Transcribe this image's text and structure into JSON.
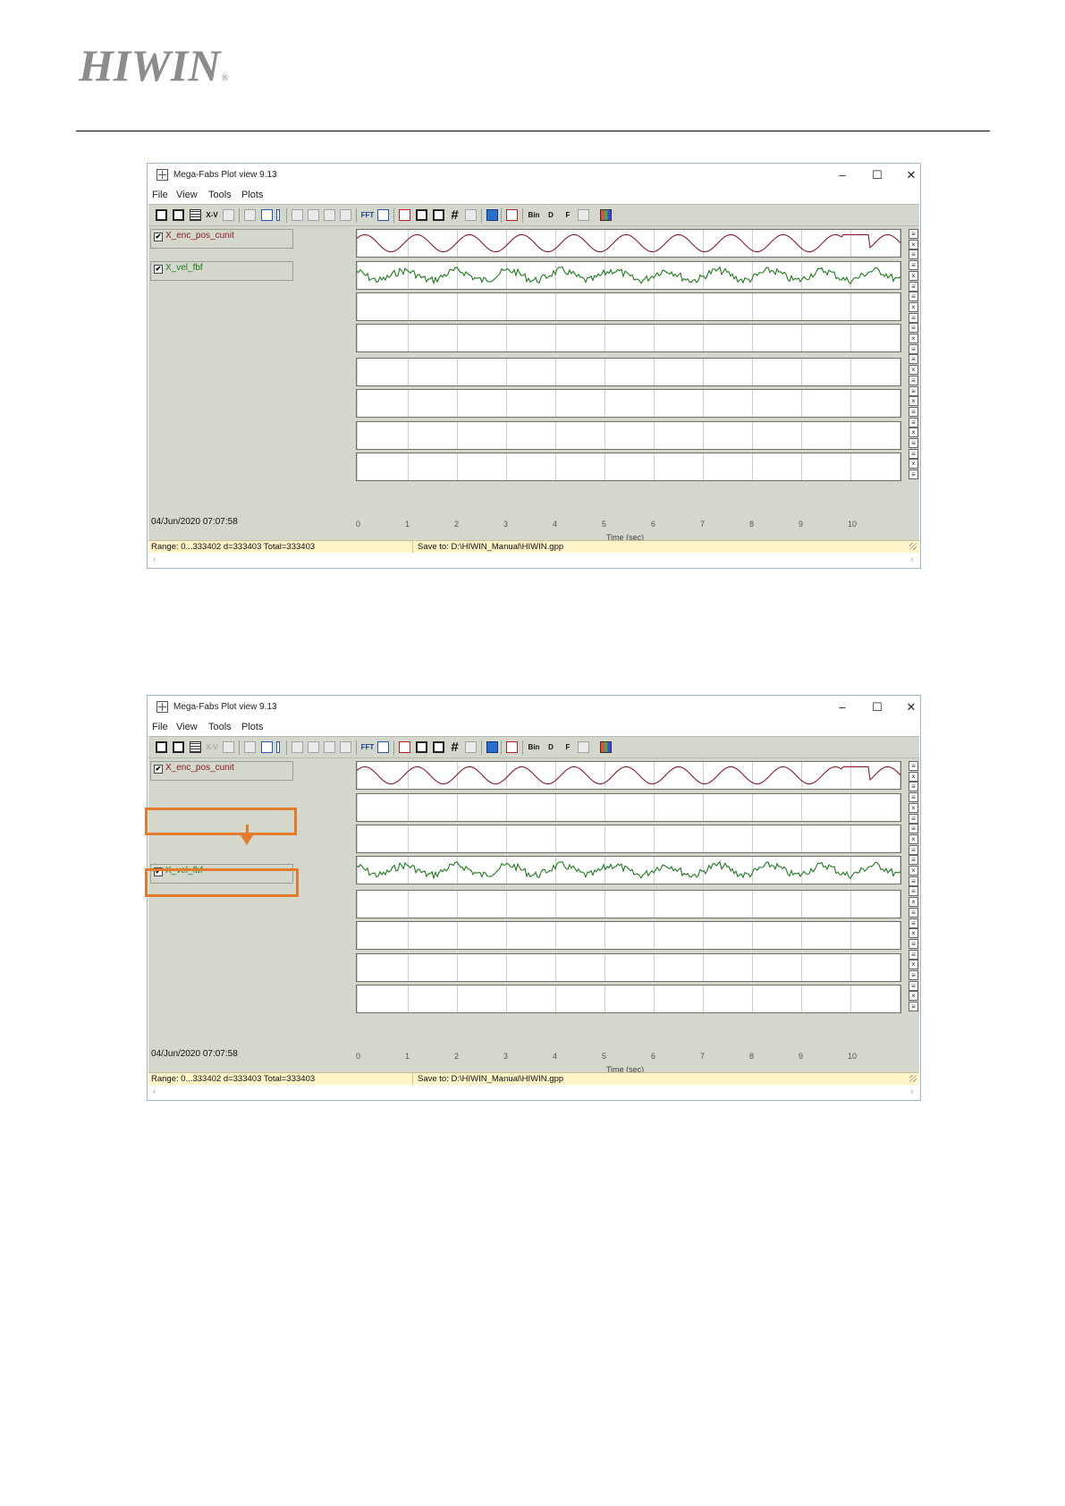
{
  "logo": {
    "text": "HIWIN",
    "mark": "®"
  },
  "windows": [
    {
      "title": "Mega-Fabs Plot view 9.13",
      "minimize": "–",
      "maximize": "☐",
      "close": "✕",
      "menu": [
        "File",
        "View",
        "Tools",
        "Plots"
      ],
      "toolbar_text": {
        "xv": "X-V",
        "fft": "FFT",
        "bin": "Bin",
        "d": "D",
        "f": "F"
      },
      "signals": [
        {
          "label": "X_enc_pos_cunit",
          "checked": "✔",
          "color": "#8b1a2a"
        },
        {
          "label": "X_vel_fbf",
          "checked": "✔",
          "color": "#1e7a1e"
        }
      ],
      "date": "04/Jun/2020  07:07:58",
      "x_ticks": [
        "0",
        "1",
        "2",
        "3",
        "4",
        "5",
        "6",
        "7",
        "8",
        "9",
        "10"
      ],
      "x_label": "Time (sec)",
      "status_range": "Range: 0...333402 d=333403 Total=333403",
      "status_save": "Save to: D:\\HIWIN_Manual\\HIWIN.gpp"
    },
    {
      "title": "Mega-Fabs Plot view 9.13",
      "minimize": "–",
      "maximize": "☐",
      "close": "✕",
      "menu": [
        "File",
        "View",
        "Tools",
        "Plots"
      ],
      "toolbar_text": {
        "xv": "X-V",
        "fft": "FFT",
        "bin": "Bin",
        "d": "D",
        "f": "F"
      },
      "signals": [
        {
          "label": "X_enc_pos_cunit",
          "checked": "✔",
          "color": "#8b1a2a"
        },
        {
          "label": "X_vel_fbf",
          "checked": "✔",
          "color": "#1e7a1e"
        }
      ],
      "date": "04/Jun/2020  07:07:58",
      "x_ticks": [
        "0",
        "1",
        "2",
        "3",
        "4",
        "5",
        "6",
        "7",
        "8",
        "9",
        "10"
      ],
      "x_label": "Time (sec)",
      "status_range": "Range: 0...333402 d=333403 Total=333403",
      "status_save": "Save to: D:\\HIWIN_Manual\\HIWIN.gpp"
    }
  ],
  "colors": {
    "highlight": "#e47a2c",
    "panel": "#d4d8cc",
    "statusbar": "#fff3c8"
  }
}
